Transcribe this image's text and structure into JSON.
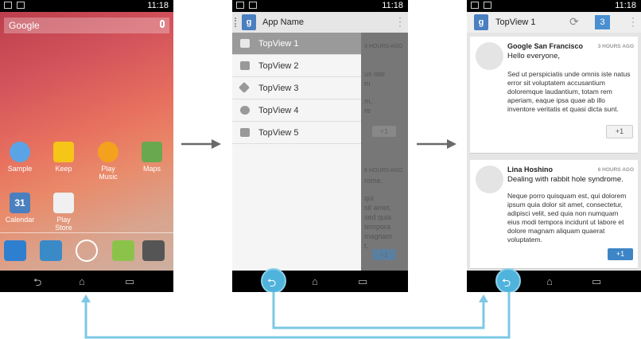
{
  "status_time": "11:18",
  "phone1": {
    "search_brand": "Google",
    "apps": [
      {
        "label": "Sample",
        "color": "#5aa4e6"
      },
      {
        "label": "Keep",
        "color": "#f5c518"
      },
      {
        "label": "Play Music",
        "color": "#f4a21d"
      },
      {
        "label": "Maps",
        "color": "#6aa84f"
      },
      {
        "label": "Calendar",
        "color": "#4a7fc0"
      },
      {
        "label": "Play Store",
        "color": "#f0f0f0"
      }
    ],
    "calendar_day": "31"
  },
  "phone2": {
    "app_name": "App Name",
    "drawer_items": [
      "TopView 1",
      "TopView 2",
      "TopView 3",
      "TopView 4",
      "TopView 5"
    ],
    "selected_index": 0,
    "background_fragments": {
      "time_a": "3 HOURS AGO",
      "line_a1": "us iste",
      "line_a2": "m",
      "line_a3": "m,",
      "line_a4": "re",
      "plus_a": "+1",
      "time_b": "6 HOURS AGO",
      "line_b1": "rome.",
      "line_b2": "qui",
      "line_b3": "sit amet,",
      "line_b4": "sed quia",
      "line_b5": "tempora",
      "line_b6": "magnam",
      "line_b7": "t.",
      "plus_b": "+1"
    }
  },
  "phone3": {
    "title": "TopView 1",
    "count": "3",
    "posts": [
      {
        "author": "Google San Francisco",
        "time": "3 HOURS AGO",
        "headline": "Hello everyone,",
        "body": "Sed ut perspiciatis unde omnis iste natus error sit voluptatem accusantium doloremque laudantium, totam rem aperiam, eaque ipsa quae ab illo inventore veritatis et quasi dicta sunt.",
        "plus": "+1",
        "plus_active": false
      },
      {
        "author": "Lina Hoshino",
        "time": "6 HOURS AGO",
        "headline": "Dealing with rabbit hole syndrome.",
        "body": "Neque porro quisquam est, qui dolorem ipsum quia dolor sit amet, consectetur, adipisci velit, sed quia non numquam eius modi tempora incidunt ut labore et dolore magnam aliquam quaerat voluptatem.",
        "plus": "+1",
        "plus_active": true
      }
    ]
  },
  "colors": {
    "flow_arrow": "#6a6a6a",
    "back_path": "#7cc8e6",
    "selected_drawer": "#9a9a9a",
    "accent_blue": "#3d85c6"
  },
  "icons": {
    "back": "back-arrow-icon",
    "home": "home-icon",
    "recents": "recents-icon"
  }
}
